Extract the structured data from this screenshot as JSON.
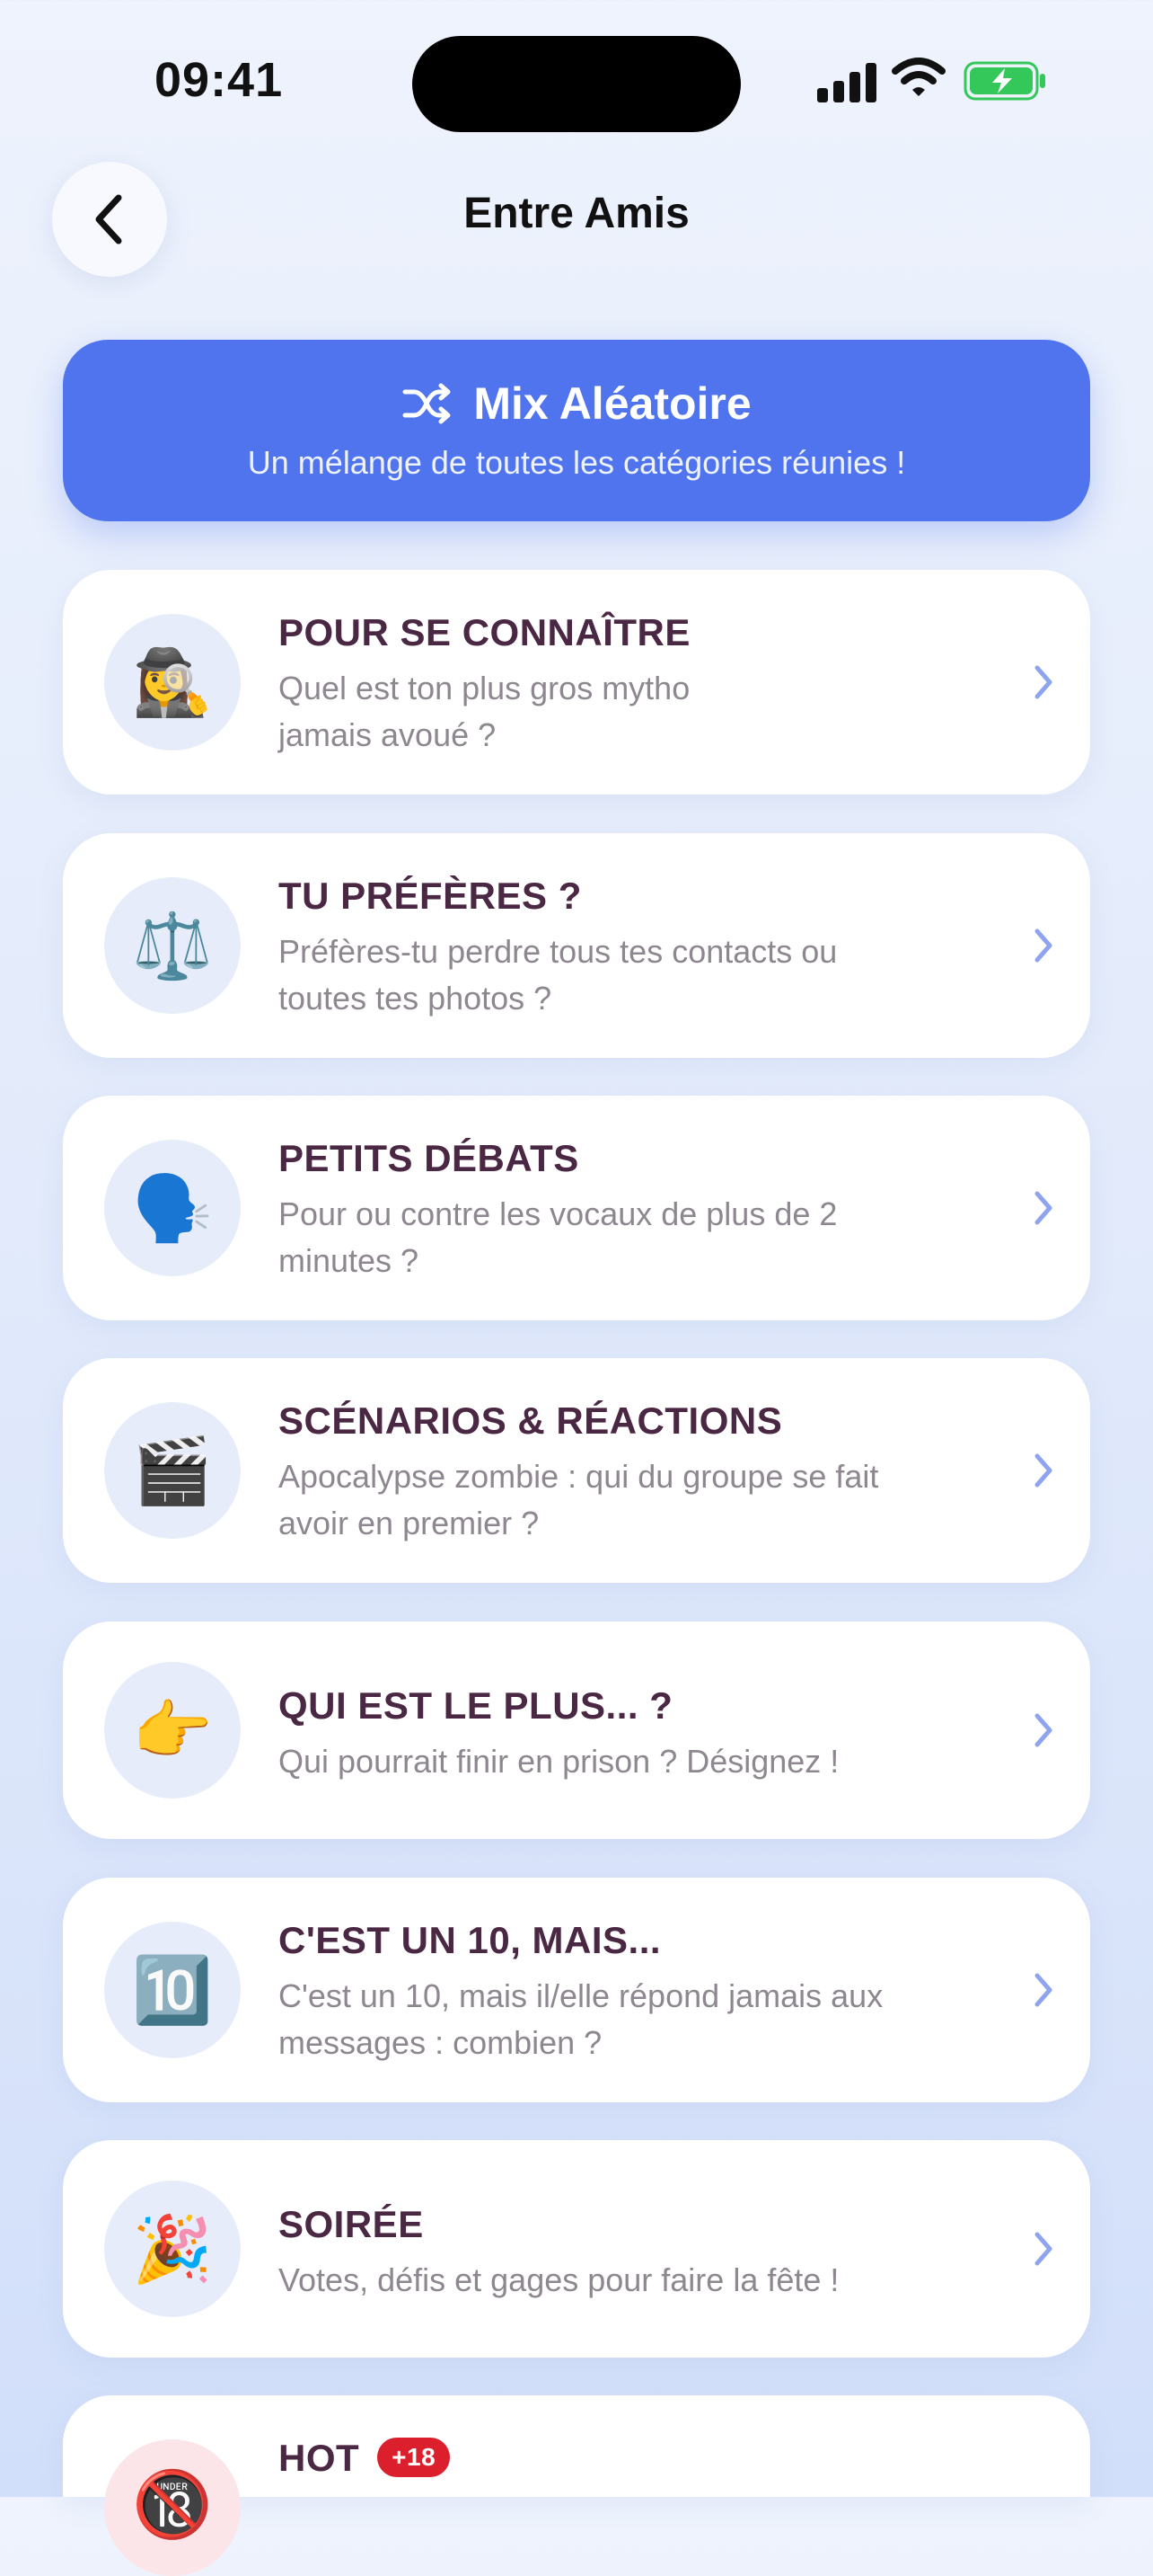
{
  "status": {
    "time": "09:41"
  },
  "header": {
    "title": "Entre Amis"
  },
  "mix": {
    "title": "Mix Aléatoire",
    "subtitle": "Un mélange de toutes les catégories réunies !"
  },
  "categories": [
    {
      "title": "POUR SE CONNAÎTRE",
      "description": "Quel est ton plus gros mytho jamais avoué ?",
      "icon": "detective-emoji",
      "emoji": "🕵️‍♀️"
    },
    {
      "title": "TU PRÉFÈRES ?",
      "description": "Préfères-tu perdre tous tes contacts ou toutes tes photos ?",
      "icon": "balance-scale-emoji",
      "emoji": "⚖️"
    },
    {
      "title": "PETITS DÉBATS",
      "description": "Pour ou contre les vocaux de plus de 2 minutes ?",
      "icon": "speaking-head-emoji",
      "emoji": "🗣️"
    },
    {
      "title": "SCÉNARIOS & RÉACTIONS",
      "description": "Apocalypse zombie : qui du groupe se fait avoir en premier ?",
      "icon": "clapper-board-emoji",
      "emoji": "🎬"
    },
    {
      "title": "QUI EST LE PLUS... ?",
      "description": "Qui pourrait finir en prison ? Désignez !",
      "icon": "pointing-hand-emoji",
      "emoji": "👉"
    },
    {
      "title": "C'EST UN 10, MAIS...",
      "description": "C'est un 10, mais il/elle répond jamais aux messages : combien ?",
      "icon": "keycap-ten-emoji",
      "emoji": "🔟"
    },
    {
      "title": "SOIRÉE",
      "description": "Votes, défis et gages pour faire la fête !",
      "icon": "party-popper-emoji",
      "emoji": "🎉"
    },
    {
      "title": "HOT",
      "badge": "+18",
      "icon": "no-under-18-emoji",
      "emoji": "🔞"
    }
  ],
  "colors": {
    "accent": "#4f74ee",
    "title_text": "#4a2742",
    "badge": "#dc1f2c",
    "battery": "#34c759"
  }
}
